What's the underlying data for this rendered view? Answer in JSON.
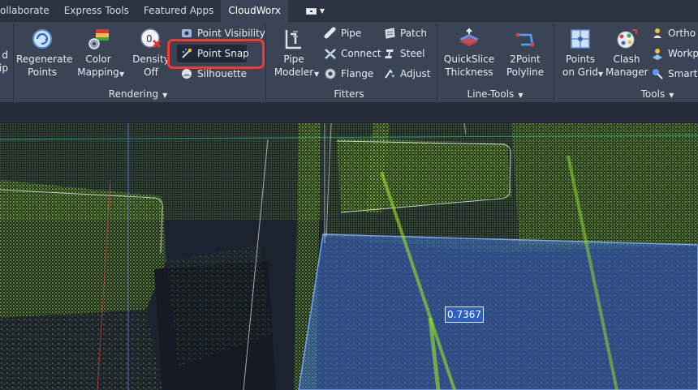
{
  "tabs": [
    {
      "label": "ollaborate",
      "active": false
    },
    {
      "label": "Express Tools",
      "active": false
    },
    {
      "label": "Featured Apps",
      "active": false
    },
    {
      "label": "CloudWorx",
      "active": true
    }
  ],
  "ribbon": {
    "cut_left": {
      "line1": "d",
      "line2": "ip"
    },
    "rendering": {
      "label": "Rendering",
      "regenerate": {
        "line1": "Regenerate",
        "line2": "Points"
      },
      "color_mapping": {
        "line1": "Color",
        "line2": "Mapping"
      },
      "density": {
        "line1": "Density",
        "line2": "Off"
      },
      "point_visibility": "Point Visibility",
      "point_snap": "Point Snap",
      "silhouette": "Silhouette"
    },
    "fitters": {
      "label": "Fitters",
      "pipe_modeler": {
        "line1": "Pipe",
        "line2": "Modeler"
      },
      "pipe": "Pipe",
      "connect": "Connect",
      "flange": "Flange",
      "patch": "Patch",
      "steel": "Steel",
      "adjust": "Adjust"
    },
    "line_tools": {
      "label": "Line-Tools",
      "quickslice": {
        "line1": "QuickSlice",
        "line2": "Thickness"
      },
      "two_point": {
        "line1": "2Point",
        "line2": "Polyline"
      }
    },
    "tools": {
      "label": "Tools",
      "points_on_grid": {
        "line1": "Points",
        "line2": "on Grid"
      },
      "clash_manager": {
        "line1": "Clash",
        "line2": "Manager"
      },
      "ortho": "Ortho I",
      "workplane": "Workpl",
      "smartpick": "SmartP"
    }
  },
  "viewport": {
    "dimension_value": "0.7367"
  },
  "colors": {
    "ribbon_bg": "#3b4455",
    "highlight": "#f23b2e",
    "point_cloud": "#8fd61e",
    "selection_plane": "#3d6fd6"
  }
}
